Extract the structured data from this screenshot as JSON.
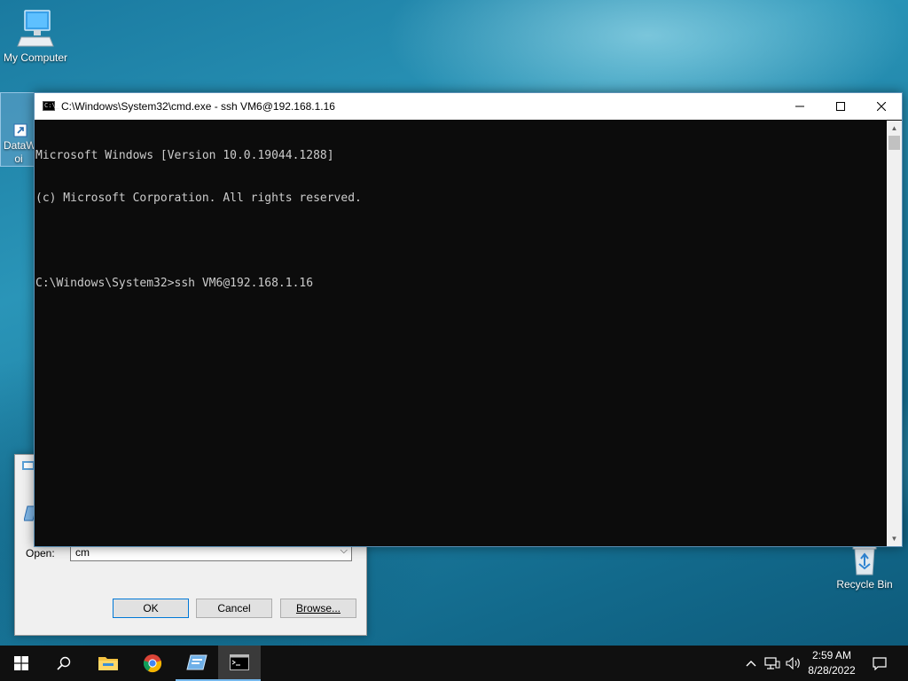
{
  "desktop": {
    "icons": [
      {
        "label": "My Computer",
        "icon": "computer-icon"
      },
      {
        "label": "DataW… oi",
        "icon": "shortcut-icon"
      },
      {
        "label": "Recycle Bin",
        "icon": "recycle-bin-icon"
      }
    ]
  },
  "run_dialog": {
    "open_label": "Open:",
    "open_value": "cm",
    "ok_label": "OK",
    "cancel_label": "Cancel",
    "browse_label": "Browse..."
  },
  "cmd_window": {
    "title": "C:\\Windows\\System32\\cmd.exe - ssh  VM6@192.168.1.16",
    "icon_text": "C:\\_",
    "lines": [
      "Microsoft Windows [Version 10.0.19044.1288]",
      "(c) Microsoft Corporation. All rights reserved.",
      "",
      "C:\\Windows\\System32>ssh VM6@192.168.1.16"
    ],
    "minimize_icon": "minimize-icon",
    "maximize_icon": "maximize-icon",
    "close_icon": "close-icon"
  },
  "taskbar": {
    "items": [
      {
        "name": "start",
        "icon": "windows-start-icon"
      },
      {
        "name": "search",
        "icon": "search-icon"
      },
      {
        "name": "file-explorer",
        "icon": "folder-icon"
      },
      {
        "name": "chrome",
        "icon": "chrome-icon"
      },
      {
        "name": "run",
        "icon": "run-icon"
      },
      {
        "name": "cmd",
        "icon": "cmd-icon",
        "active": true
      }
    ],
    "clock_time": "2:59 AM",
    "clock_date": "8/28/2022"
  },
  "colors": {
    "console_bg": "#0c0c0c",
    "console_fg": "#cccccc",
    "taskbar_bg": "#101010",
    "accent": "#0078d7"
  }
}
